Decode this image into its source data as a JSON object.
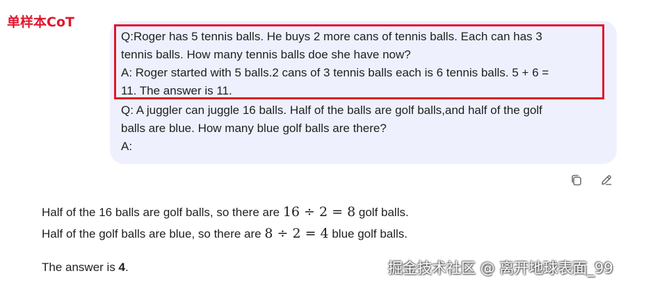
{
  "corner_label": "单样本CoT",
  "prompt": {
    "lines": [
      "Q:Roger has 5 tennis balls. He buys 2 more cans of tennis balls. Each can has 3",
      "tennis balls. How many tennis balls doe she have now?",
      "A: Roger started with 5 balls.2 cans of 3 tennis balls each is 6 tennis balls. 5 + 6 =",
      "11. The answer is 11.",
      "Q: A juggler can juggle 16 balls. Half of the balls are golf balls,and half of the golf",
      "balls are blue. How many blue golf balls are there?",
      "A:"
    ]
  },
  "actions": {
    "copy_icon": "copy-icon",
    "edit_icon": "edit-pencil-icon"
  },
  "answer": {
    "line1_prefix": "Half of the 16 balls are golf balls, so there are ",
    "line1_math": "16 ÷ 2 = 8",
    "line1_suffix": " golf balls.",
    "line2_prefix": "Half of the golf balls are blue, so there are ",
    "line2_math": "8 ÷ 2 = 4",
    "line2_suffix": " blue golf balls.",
    "line3_prefix": "The answer is ",
    "line3_value": "4",
    "line3_suffix": "."
  },
  "watermark": "掘金技术社区 @ 离开地球表面_99"
}
